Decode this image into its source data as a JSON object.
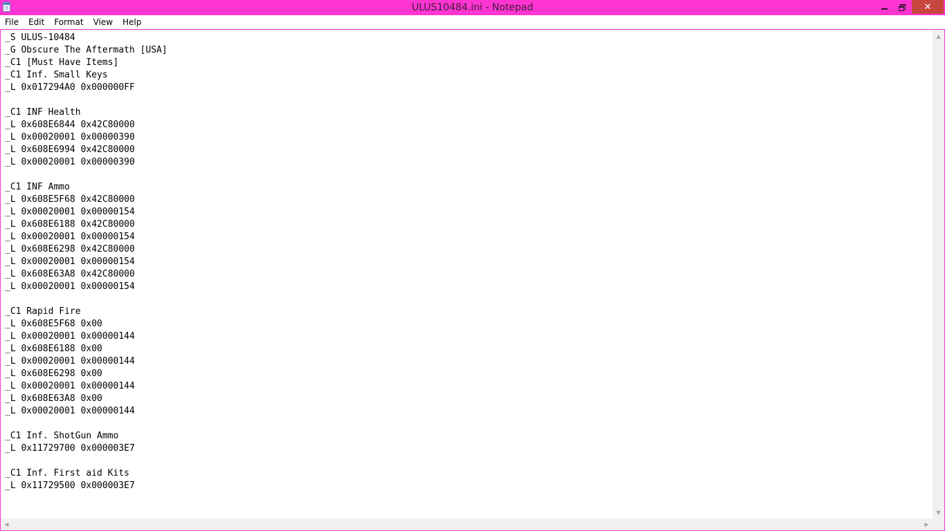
{
  "window": {
    "title": "ULUS10484.ini - Notepad",
    "controls": {
      "minimize_icon": "minimize-icon",
      "restore_icon": "restore-icon",
      "close_glyph": "✕"
    },
    "titlebar_color": "#ff35d1",
    "close_color": "#c7463d"
  },
  "menu": {
    "items": [
      {
        "label": "File"
      },
      {
        "label": "Edit"
      },
      {
        "label": "Format"
      },
      {
        "label": "View"
      },
      {
        "label": "Help"
      }
    ]
  },
  "editor": {
    "lines": [
      "_S ULUS-10484",
      "_G Obscure The Aftermath [USA]",
      "_C1 [Must Have Items]",
      "_C1 Inf. Small Keys",
      "_L 0x017294A0 0x000000FF",
      "",
      "_C1 INF Health",
      "_L 0x608E6844 0x42C80000",
      "_L 0x00020001 0x00000390",
      "_L 0x608E6994 0x42C80000",
      "_L 0x00020001 0x00000390",
      "",
      "_C1 INF Ammo",
      "_L 0x608E5F68 0x42C80000",
      "_L 0x00020001 0x00000154",
      "_L 0x608E6188 0x42C80000",
      "_L 0x00020001 0x00000154",
      "_L 0x608E6298 0x42C80000",
      "_L 0x00020001 0x00000154",
      "_L 0x608E63A8 0x42C80000",
      "_L 0x00020001 0x00000154",
      "",
      "_C1 Rapid Fire",
      "_L 0x608E5F68 0x00",
      "_L 0x00020001 0x00000144",
      "_L 0x608E6188 0x00",
      "_L 0x00020001 0x00000144",
      "_L 0x608E6298 0x00",
      "_L 0x00020001 0x00000144",
      "_L 0x608E63A8 0x00",
      "_L 0x00020001 0x00000144",
      "",
      "_C1 Inf. ShotGun Ammo",
      "_L 0x11729700 0x000003E7",
      "",
      "_C1 Inf. First aid Kits",
      "_L 0x11729500 0x000003E7"
    ]
  },
  "scrollbars": {
    "up_arrow": "▲",
    "down_arrow": "▼",
    "left_arrow": "◀",
    "right_arrow": "▶"
  }
}
